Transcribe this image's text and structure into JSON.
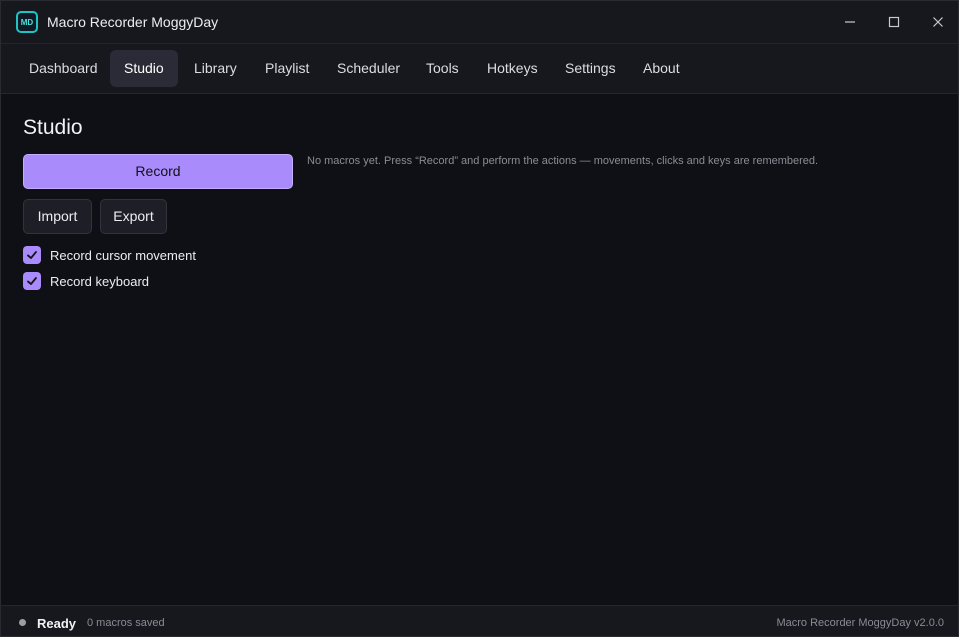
{
  "window": {
    "title": "Macro Recorder MoggyDay",
    "logo_text": "MD",
    "controls": [
      "minimize-icon",
      "maximize-icon",
      "close-icon"
    ]
  },
  "nav": {
    "tabs": [
      {
        "label": "Dashboard",
        "active": false
      },
      {
        "label": "Studio",
        "active": true
      },
      {
        "label": "Library",
        "active": false
      },
      {
        "label": "Playlist",
        "active": false
      },
      {
        "label": "Scheduler",
        "active": false
      },
      {
        "label": "Tools",
        "active": false
      },
      {
        "label": "Hotkeys",
        "active": false
      },
      {
        "label": "Settings",
        "active": false
      },
      {
        "label": "About",
        "active": false
      }
    ]
  },
  "studio": {
    "title": "Studio",
    "record_label": "Record",
    "import_label": "Import",
    "export_label": "Export",
    "options": [
      {
        "label": "Record cursor movement",
        "checked": true
      },
      {
        "label": "Record keyboard",
        "checked": true
      }
    ],
    "empty_message": "No macros yet. Press “Record” and perform the actions — movements, clicks and keys are remembered."
  },
  "status": {
    "state": "Ready",
    "count": "0 macros saved",
    "version": "Macro Recorder MoggyDay v2.0.0"
  },
  "colors": {
    "accent": "#a98bfb",
    "background": "#0f1015",
    "bar": "#17181e",
    "logo_border": "#1ec4c4"
  }
}
